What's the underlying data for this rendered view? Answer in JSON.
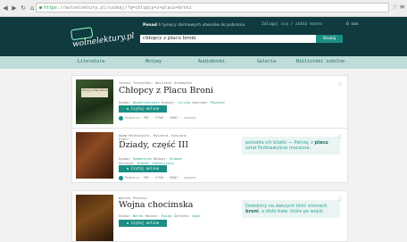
{
  "browser": {
    "url_scheme": "https",
    "url_rest": "://wolnelektury.pl/szukaj/?q=chlopcy+z+placu+broni"
  },
  "header": {
    "logo_text": "wolnelektury.pl",
    "promo_prefix": "Ponad",
    "promo_rest": "6 tysięcy darmowych utworów do pobrania",
    "user_links": "Zaloguj się / załóż konto",
    "user_name": "O nas",
    "search_value": "chłopcy z placu broni",
    "search_button": "Szukaj"
  },
  "nav": [
    "Literatura",
    "Motywy",
    "Audiobooki",
    "Galeria",
    "Biblioteki szkolne"
  ],
  "results": [
    {
      "authors": "Janusz Tuszyński, Wojciech Grabowski",
      "title": "Chłopcy z Placu Broni",
      "epoch_label": "Epoka:",
      "epoch": "Współczesność",
      "kind_label": "Rodzaj:",
      "kind": "Liryka",
      "genre_label": "Gatunek:",
      "genre": "Powieść",
      "read_button": "Czytaj online",
      "formats": "Pobierz: PDF · EPUB · MOBI · więcej",
      "quote": ""
    },
    {
      "authors": "Adam Mickiewicz, Ryszard, Ryszard,",
      "authors2": "Piotr",
      "title": "Dziady, część III",
      "epoch_label": "Epoka:",
      "epoch": "Romantyzm",
      "kind_label": "Rodzaj:",
      "kind": "Dramat",
      "genre_label": "Gatunek:",
      "genre": "Dramat romantyczny",
      "read_button": "Czytaj online",
      "formats": "Pobierz: PDF · EPUB · MOBI · więcej",
      "quote_pre": "polowiła ich bilatki — Patrzą, z",
      "quote_bold": "placu",
      "quote_post": "ostał Podstawyście moczone."
    },
    {
      "authors": "Wacław Potocki",
      "title": "Wojna chocimska",
      "epoch_label": "Epoka:",
      "epoch": "Barok",
      "kind_label": "Rodzaj:",
      "kind": "Epika",
      "genre_label": "Gatunek:",
      "genre": "Epos",
      "read_button": "Czytaj online",
      "formats": "",
      "quote_pre": "Dziedziny na dalszych lśnić stronach",
      "quote_bold": "broni",
      "quote_post": ", a złoto bałe, które po wojsk."
    }
  ]
}
